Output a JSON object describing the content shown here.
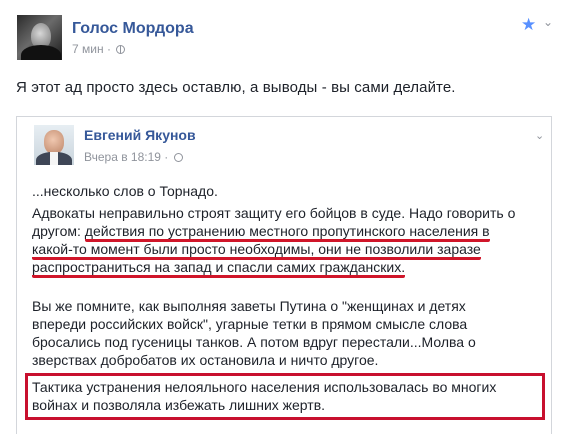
{
  "post": {
    "page_name": "Голос Мордора",
    "time": "7 мин",
    "separator": "·",
    "text": "Я этот ад просто здесь оставлю, а выводы - вы сами делайте.",
    "accent_color": "#365899",
    "star_icon": "star-icon",
    "chevron_icon": "chevron-down-icon"
  },
  "embedded_post": {
    "author": "Евгений Якунов",
    "time": "Вчера в 18:19",
    "separator": "·",
    "paragraphs": {
      "intro": "...несколько слов о Торнадо.",
      "p1": {
        "line1": "Адвокаты неправильно строят защиту его бойцов в суде. Надо говорить о",
        "line2_prefix": "другом: ",
        "line2_underlined": "действия по устранению местного пропутинского населения в",
        "line3": "какой-то момент были просто необходимы, они не позволили заразе",
        "line4": "распространиться на запад и спасли самих гражданских."
      },
      "p2": {
        "line1": "Вы же помните, как выполняя заветы Путина о \"женщинах и детях",
        "line2": "впереди российских войск\", угарные тетки в прямом смысле слова",
        "line3": "бросались под гусеницы танков. А потом вдруг перестали...Молва о",
        "line4": "зверствах добробатов их остановила и ничто другое."
      },
      "p3": {
        "line1": "Тактика устранения нелояльного населения использовалась во многих",
        "line2": "войнах и позволяла избежать лишних жертв."
      }
    },
    "annotation_color": "#c8102e"
  }
}
